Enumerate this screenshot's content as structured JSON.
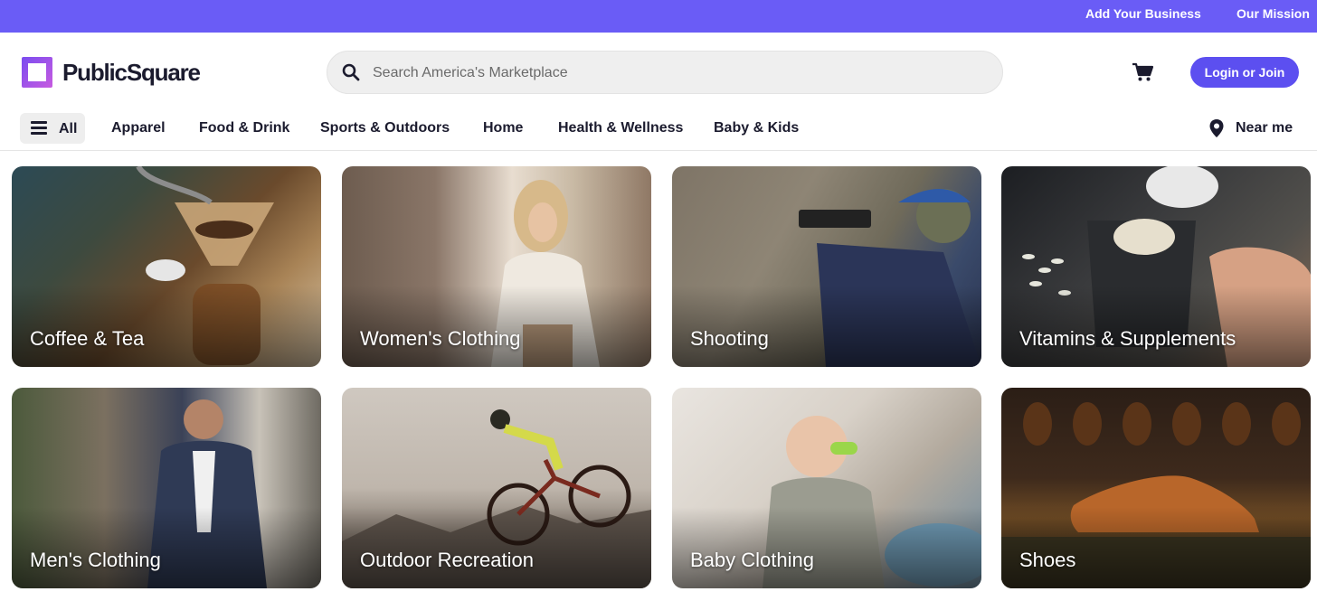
{
  "topbar": {
    "links": [
      "Add Your Business",
      "Our Mission"
    ]
  },
  "brand": {
    "name": "PublicSquare"
  },
  "search": {
    "placeholder": "Search America's Marketplace"
  },
  "header": {
    "login_label": "Login or Join"
  },
  "catnav": {
    "all_label": "All",
    "items": [
      "Apparel",
      "Food & Drink",
      "Sports & Outdoors",
      "Home",
      "Health & Wellness",
      "Baby & Kids"
    ],
    "near_label": "Near me"
  },
  "categories": [
    {
      "label": "Coffee & Tea"
    },
    {
      "label": "Women's Clothing"
    },
    {
      "label": "Shooting"
    },
    {
      "label": "Vitamins & Supplements"
    },
    {
      "label": "Men's Clothing"
    },
    {
      "label": "Outdoor Recreation"
    },
    {
      "label": "Baby Clothing"
    },
    {
      "label": "Shoes"
    }
  ],
  "colors": {
    "accent": "#6a5cf6",
    "button": "#5c4ff0"
  },
  "icons": [
    "search-icon",
    "cart-icon",
    "menu-icon",
    "location-pin-icon"
  ]
}
